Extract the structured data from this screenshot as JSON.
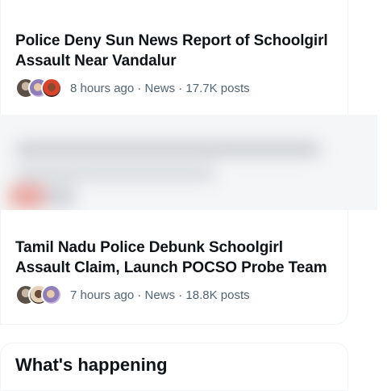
{
  "stories": [
    {
      "title_line1": "Police Deny Sun News Report of Schoolgirl",
      "title_line2": "Assault Near Vandalur",
      "meta": "8 hours ago · News · 17.7K posts"
    },
    {
      "title_line1": "Tamil Nadu Police Debunk Schoolgirl",
      "title_line2": "Assault Claim, Launch POCSO Probe Team",
      "meta": "7 hours ago · News · 18.8K posts"
    }
  ],
  "next_section": {
    "title": "What's happening"
  },
  "colors": {
    "text_primary": "#0f1419",
    "text_secondary": "#536471",
    "border": "#eff3f4"
  },
  "icons": {
    "story1_avatars": [
      "avatar-person-icon",
      "avatar-person-icon",
      "avatar-person-icon"
    ],
    "story2_avatars": [
      "avatar-person-icon",
      "avatar-person-icon",
      "avatar-person-icon"
    ]
  }
}
